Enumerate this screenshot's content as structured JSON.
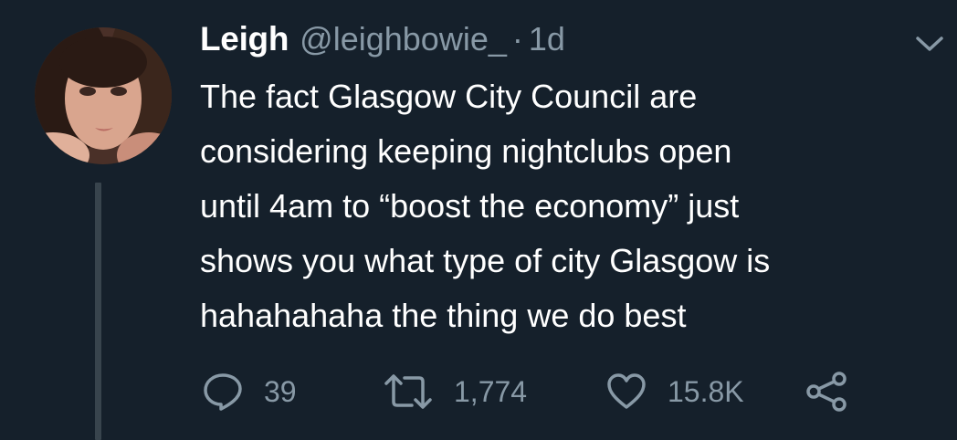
{
  "tweet": {
    "author_name": "Leigh",
    "author_handle": "@leighbowie_",
    "separator": "·",
    "timestamp": "1d",
    "text_lines": [
      "The fact Glasgow City Council are",
      "considering keeping nightclubs open",
      "until 4am to “boost the economy” just",
      "shows you what type of city Glasgow is",
      "hahahahaha the thing we do best"
    ],
    "actions": {
      "reply_count": "39",
      "retweet_count": "1,774",
      "like_count": "15.8K"
    }
  },
  "colors": {
    "background": "#15202b",
    "primary_text": "#ffffff",
    "secondary_text": "#8899a6",
    "thread_line": "#38444d"
  },
  "icons": [
    "more-chevron-icon",
    "reply-icon",
    "retweet-icon",
    "like-icon",
    "share-icon"
  ]
}
